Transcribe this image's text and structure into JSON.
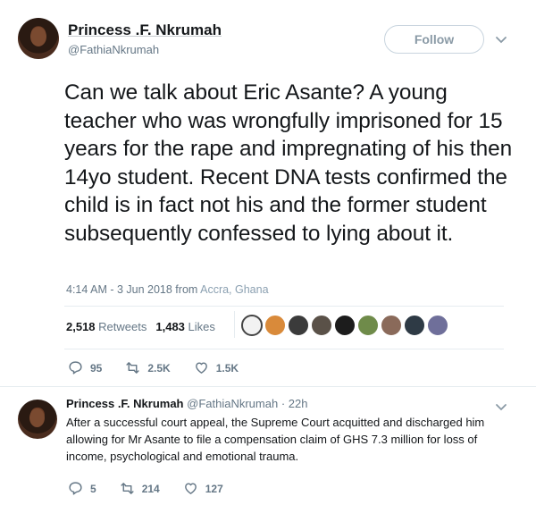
{
  "tweet": {
    "author_name": "Princess .F. Nkrumah",
    "author_handle": "@FathiaNkrumah",
    "follow_label": "Follow",
    "text": "Can we talk about Eric Asante? A young teacher who was wrongfully imprisoned for 15 years for the rape and impregnating of his then 14yo student. Recent DNA tests confirmed the child is in fact not his and the former student subsequently confessed to lying about it.",
    "time": "4:14 AM - 3 Jun 2018 from",
    "location": "Accra, Ghana",
    "retweets_count": "2,518",
    "retweets_label": "Retweets",
    "likes_count": "1,483",
    "likes_label": "Likes",
    "reply_count": "95",
    "retweet_count_short": "2.5K",
    "like_count_short": "1.5K"
  },
  "reply": {
    "author_name": "Princess .F. Nkrumah",
    "author_handle": "@FathiaNkrumah",
    "time": "· 22h",
    "text": "After a successful court appeal, the Supreme Court acquitted and discharged him allowing for Mr Asante to file a compensation claim of GHS 7.3 million for loss of income, psychological and emotional trauma.",
    "reply_count": "5",
    "retweet_count": "214",
    "like_count": "127"
  },
  "colors": {
    "text": "#14171a",
    "secondary": "#657786",
    "divider": "#e6ecf0"
  },
  "icons": [
    "chevron-down-icon",
    "reply-icon",
    "retweet-icon",
    "heart-icon"
  ]
}
